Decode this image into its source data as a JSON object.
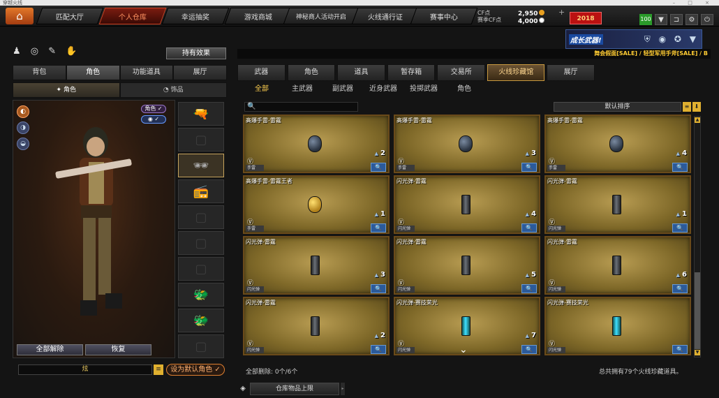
{
  "window": {
    "title": "穿越火线",
    "controls": "– □ ×"
  },
  "topnav": {
    "home_icon": "⌂",
    "tabs": [
      "匹配大厅",
      "个人仓库",
      "幸运抽奖",
      "游戏商城",
      "神秘商人活动开启",
      "火线通行证",
      "赛事中心"
    ],
    "active_tab": "个人仓库",
    "cf_label": "CF点",
    "season_cf_label": "赛季CF点",
    "cf_value": "2,950",
    "season_cf_value": "4,000",
    "plus": "+",
    "event_badge": "2018",
    "level": "100",
    "icons": [
      "▼",
      "⊐",
      "⚙",
      "⏻"
    ]
  },
  "left": {
    "toolbar_icons": "♟ ◎ ✎ ✋",
    "effect_button": "持有效果",
    "tabs": [
      "背包",
      "角色",
      "功能道具",
      "展厅"
    ],
    "active_tab": "角色",
    "subtabs": [
      "✦ 角色",
      "◔ 饰品"
    ],
    "active_subtab": "✦ 角色",
    "color_buttons": [
      "◐",
      "◑",
      "◒"
    ],
    "role_tag": "角色 ✓",
    "eye_tag": "◉ ✓",
    "equip_slots": [
      "🔫",
      "▢",
      "🕶",
      "📻",
      "▢",
      "▢",
      "▢",
      "🐲",
      "🐲",
      "▢"
    ],
    "clear_button": "全部解除",
    "restore_button": "恢复",
    "name_field": "炫",
    "name_list_icon": "≡",
    "set_default_button": "设为默认角色 ✓"
  },
  "right": {
    "banner_text": "成长武器!",
    "banner_icons": "⛨ ◉ ✪ ▼",
    "sale_text": "舞会假面[SALE] / 轻型军用手斧[SALE] / B",
    "tabs": [
      "武器",
      "角色",
      "道具",
      "暂存箱",
      "交易所",
      "火线珍藏馆",
      "展厅"
    ],
    "active_tab": "火线珍藏馆",
    "subtabs": [
      "全部",
      "主武器",
      "副武器",
      "近身武器",
      "投掷武器",
      "角色"
    ],
    "active_subtab": "全部",
    "search_icon": "🔍",
    "search_placeholder": "",
    "sort_label": "默认排序",
    "sort_list_icon": "≡",
    "sort_dir_icon": "⬇",
    "scroll_up": "▲",
    "scroll_down": "▼",
    "down_chevron": "⌄",
    "items": [
      {
        "name": "高爆手雷-雷霆",
        "count": "2",
        "type": "手雷",
        "art": "grenade"
      },
      {
        "name": "高爆手雷-雷霆",
        "count": "3",
        "type": "手雷",
        "art": "grenade"
      },
      {
        "name": "高爆手雷-雷霆",
        "count": "4",
        "type": "手雷",
        "art": "grenade"
      },
      {
        "name": "高爆手雷-雷霆王者",
        "count": "1",
        "type": "手雷",
        "art": "grenade gold"
      },
      {
        "name": "闪光弹-雷霆",
        "count": "4",
        "type": "闪光弹",
        "art": "flash"
      },
      {
        "name": "闪光弹-雷霆",
        "count": "1",
        "type": "闪光弹",
        "art": "flash"
      },
      {
        "name": "闪光弹-雷霆",
        "count": "3",
        "type": "闪光弹",
        "art": "flash"
      },
      {
        "name": "闪光弹-雷霆",
        "count": "5",
        "type": "闪光弹",
        "art": "flash"
      },
      {
        "name": "闪光弹-雷霆",
        "count": "6",
        "type": "闪光弹",
        "art": "flash"
      },
      {
        "name": "闪光弹-雷霆",
        "count": "2",
        "type": "闪光弹",
        "art": "flash"
      },
      {
        "name": "闪光弹-赛技荣光",
        "count": "7",
        "type": "闪光弹",
        "art": "flash blue"
      },
      {
        "name": "闪光弹-赛技荣光",
        "count": "",
        "type": "闪光弹",
        "art": "flash blue"
      }
    ],
    "vip_icon": "Ⓥ",
    "magnify_icon": "🔍",
    "clear_all_text": "全部删除: 0个/6个",
    "total_text": "总共拥有79个火线珍藏道具。",
    "store_icon": "◈",
    "store_limit_label": "仓库物品上限",
    "store_arrow": "▸"
  }
}
